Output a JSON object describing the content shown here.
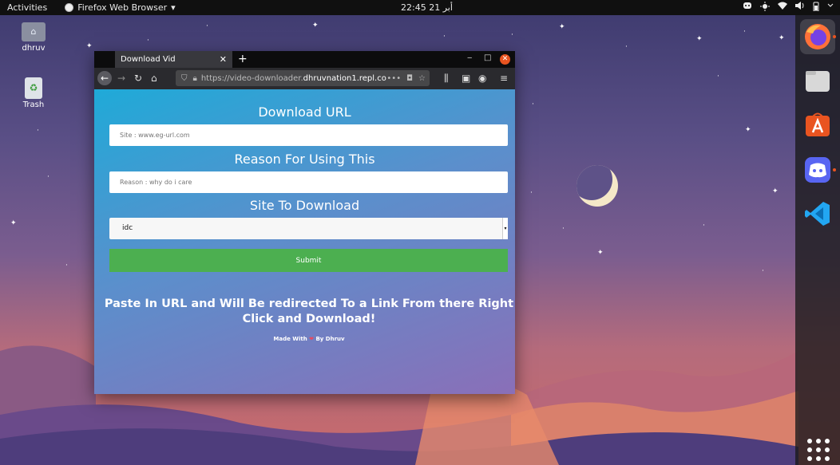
{
  "topbar": {
    "activities": "Activities",
    "app_name": "Firefox Web Browser",
    "app_menu_arrow": "▾",
    "clock": "22:45  21 أبر",
    "tray_icons": [
      "discord-tray-icon",
      "brightness-icon",
      "wifi-icon",
      "volume-icon",
      "battery-icon",
      "power-menu-icon"
    ]
  },
  "desktop": {
    "home_label": "dhruv",
    "trash_label": "Trash"
  },
  "dock": {
    "items": [
      "firefox",
      "files",
      "ubuntu-software",
      "discord",
      "vscode"
    ],
    "accent": "#e95420"
  },
  "browser": {
    "tab_title": "Download Vid",
    "tab_close": "✕",
    "new_tab": "+",
    "url_prefix": "https://video-downloader.",
    "url_host": "dhruvnation1.repl.co",
    "url_more": "•••"
  },
  "page": {
    "download_url_heading": "Download URL",
    "url_placeholder": "Site : www.eg-url.com",
    "reason_heading": "Reason For Using This",
    "reason_placeholder": "Reason : why do i care",
    "site_heading": "Site To Download",
    "site_selected": "idc",
    "submit_label": "Submit",
    "message": "Paste In URL and Will Be redirected To a Link From there Right Click and Download!",
    "made_with_prefix": "Made With",
    "made_with_heart": "❤",
    "made_with_suffix": "By Dhruv",
    "submit_color": "#4caf50"
  }
}
